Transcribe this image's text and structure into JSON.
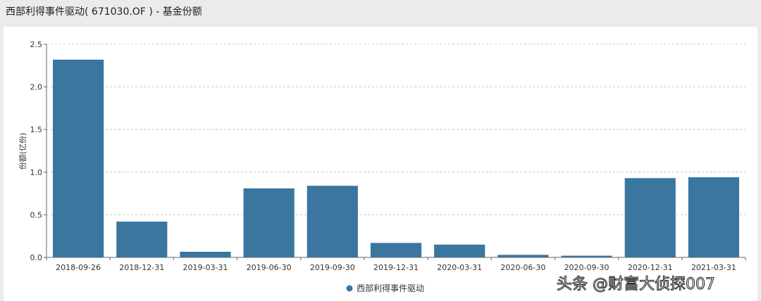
{
  "header": {
    "title": "西部利得事件驱动( 671030.OF ) - 基金份额"
  },
  "watermark": "头条 @财富大侦探007",
  "chart_data": {
    "type": "bar",
    "title": "西部利得事件驱动( 671030.OF ) - 基金份额",
    "xlabel": "",
    "ylabel": "份额(亿份)",
    "ylim": [
      0,
      2.5
    ],
    "yticks": [
      "0.0",
      "0.5",
      "1.0",
      "1.5",
      "2.0",
      "2.5"
    ],
    "grid": true,
    "legend_position": "bottom",
    "color": "#3a76a0",
    "categories": [
      "2018-09-26",
      "2018-12-31",
      "2019-03-31",
      "2019-06-30",
      "2019-09-30",
      "2019-12-31",
      "2020-03-31",
      "2020-06-30",
      "2020-09-30",
      "2020-12-31",
      "2021-03-31"
    ],
    "series": [
      {
        "name": "西部利得事件驱动",
        "values": [
          2.32,
          0.42,
          0.066,
          0.81,
          0.84,
          0.17,
          0.15,
          0.03,
          0.02,
          0.93,
          0.94
        ]
      }
    ]
  }
}
